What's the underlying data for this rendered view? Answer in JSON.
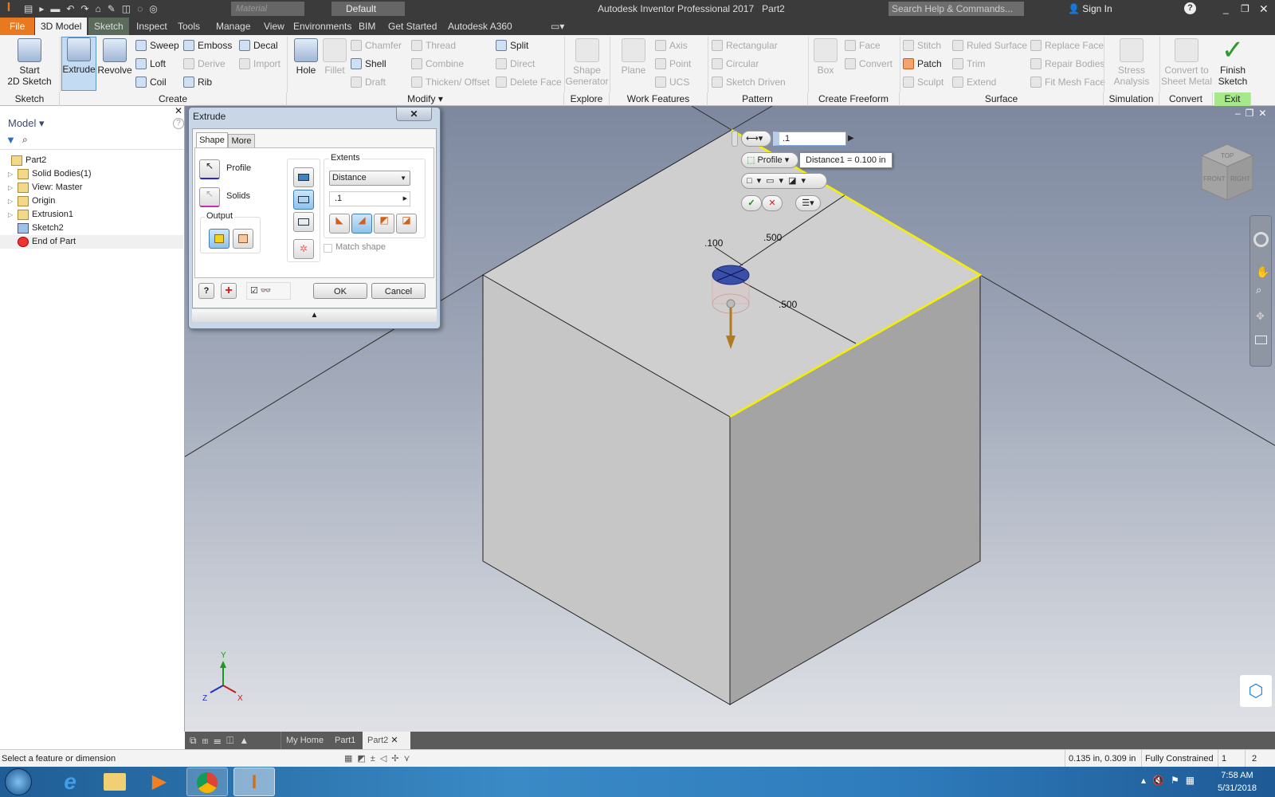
{
  "app": {
    "title": "Autodesk Inventor Professional 2017",
    "document": "Part2",
    "search_placeholder": "Search Help & Commands...",
    "sign_in": "Sign In",
    "material": "Material",
    "appearance": "Default"
  },
  "tabs": [
    {
      "label": "File"
    },
    {
      "label": "3D Model"
    },
    {
      "label": "Sketch"
    },
    {
      "label": "Inspect"
    },
    {
      "label": "Tools"
    },
    {
      "label": "Manage"
    },
    {
      "label": "View"
    },
    {
      "label": "Environments"
    },
    {
      "label": "BIM"
    },
    {
      "label": "Get Started"
    },
    {
      "label": "Autodesk A360"
    }
  ],
  "ribbon": {
    "large": [
      {
        "label": "Start\n2D Sketch"
      },
      {
        "label": "Extrude"
      },
      {
        "label": "Revolve"
      },
      {
        "label": "Hole"
      },
      {
        "label": "Fillet"
      },
      {
        "label": "Shape\nGenerator"
      },
      {
        "label": "Plane"
      },
      {
        "label": "Box"
      },
      {
        "label": "Stress\nAnalysis"
      },
      {
        "label": "Convert to\nSheet Metal"
      },
      {
        "label": "Finish\nSketch"
      }
    ],
    "small": [
      {
        "label": "Sweep"
      },
      {
        "label": "Loft"
      },
      {
        "label": "Coil"
      },
      {
        "label": "Emboss"
      },
      {
        "label": "Derive"
      },
      {
        "label": "Rib"
      },
      {
        "label": "Decal"
      },
      {
        "label": "Import"
      },
      {
        "label": "Chamfer"
      },
      {
        "label": "Shell"
      },
      {
        "label": "Draft"
      },
      {
        "label": "Thread"
      },
      {
        "label": "Combine"
      },
      {
        "label": "Thicken/ Offset"
      },
      {
        "label": "Split"
      },
      {
        "label": "Direct"
      },
      {
        "label": "Delete Face"
      },
      {
        "label": "Axis"
      },
      {
        "label": "Point"
      },
      {
        "label": "UCS"
      },
      {
        "label": "Rectangular"
      },
      {
        "label": "Circular"
      },
      {
        "label": "Sketch Driven"
      },
      {
        "label": "Face"
      },
      {
        "label": "Convert"
      },
      {
        "label": "Stitch"
      },
      {
        "label": "Patch"
      },
      {
        "label": "Sculpt"
      },
      {
        "label": "Ruled Surface"
      },
      {
        "label": "Trim"
      },
      {
        "label": "Extend"
      },
      {
        "label": "Replace Face"
      },
      {
        "label": "Repair Bodies"
      },
      {
        "label": "Fit Mesh Face"
      }
    ],
    "panels": [
      {
        "label": "Sketch"
      },
      {
        "label": "Create"
      },
      {
        "label": "Modify ▾"
      },
      {
        "label": "Explore"
      },
      {
        "label": "Work Features"
      },
      {
        "label": "Pattern"
      },
      {
        "label": "Create Freeform"
      },
      {
        "label": "Surface"
      },
      {
        "label": "Simulation"
      },
      {
        "label": "Convert"
      },
      {
        "label": "Exit"
      }
    ]
  },
  "browser": {
    "title": "Model ▾",
    "items": [
      {
        "label": "Part2"
      },
      {
        "label": "Solid Bodies(1)"
      },
      {
        "label": "View: Master"
      },
      {
        "label": "Origin"
      },
      {
        "label": "Extrusion1"
      },
      {
        "label": "Sketch2"
      },
      {
        "label": "End of Part"
      }
    ]
  },
  "dialog": {
    "title": "Extrude",
    "tabs": [
      "Shape",
      "More"
    ],
    "profile": "Profile",
    "solids": "Solids",
    "output": "Output",
    "extents": "Extents",
    "extent_type": "Distance",
    "distance": ".1",
    "match_shape": "Match shape",
    "ok": "OK",
    "cancel": "Cancel"
  },
  "minitoolbar": {
    "distance": ".1",
    "profile": "Profile",
    "tooltip": "Distance1 = 0.100 in"
  },
  "dimensions": [
    ".100",
    ".500",
    ".500"
  ],
  "viewcube": {
    "top": "TOP",
    "front": "FRONT",
    "right": "RIGHT"
  },
  "triad": {
    "x": "X",
    "y": "Y",
    "z": "Z"
  },
  "doc_tabs": [
    {
      "label": "My Home"
    },
    {
      "label": "Part1"
    },
    {
      "label": "Part2"
    }
  ],
  "status": {
    "prompt": "Select a feature or dimension",
    "coords": "0.135 in, 0.309 in",
    "constraint": "Fully Constrained",
    "count1": "1",
    "count2": "2"
  },
  "taskbar": {
    "time": "7:58 AM",
    "date": "5/31/2018"
  },
  "colors": {
    "file_tab": "#e8791e",
    "highlight_edge": "#ffff00",
    "exit_panel": "#a6e88a",
    "profile_fill": "#3a4fa8",
    "arrow": "#b07a1e"
  }
}
